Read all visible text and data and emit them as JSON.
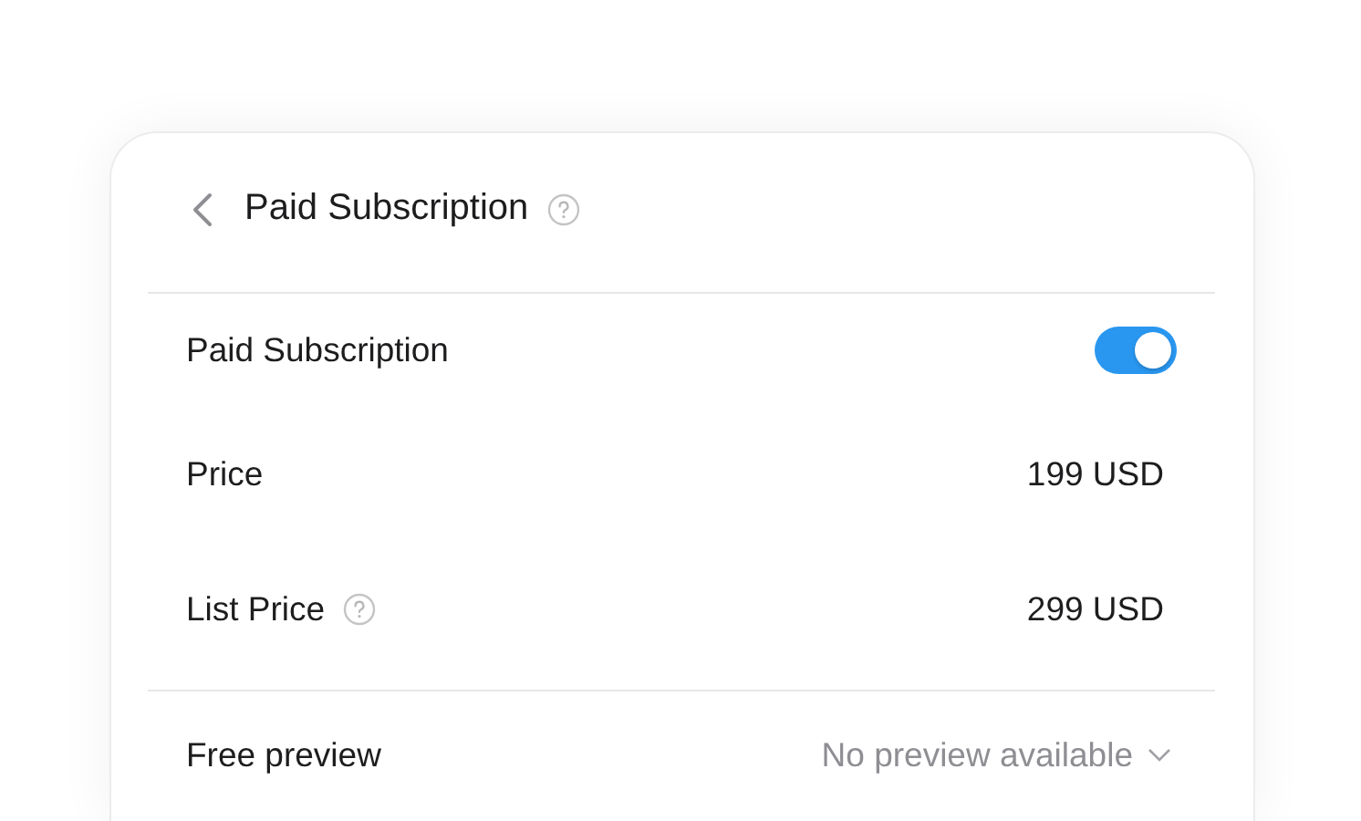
{
  "header": {
    "title": "Paid Subscription"
  },
  "sections": [
    {
      "rows": [
        {
          "kind": "toggle",
          "label": "Paid Subscription",
          "on": true
        },
        {
          "kind": "value",
          "label": "Price",
          "value": "199 USD",
          "help": false
        },
        {
          "kind": "value",
          "label": "List Price",
          "value": "299 USD",
          "help": true
        }
      ]
    },
    {
      "rows": [
        {
          "kind": "select",
          "label": "Free preview",
          "value": "No preview available"
        }
      ]
    }
  ]
}
